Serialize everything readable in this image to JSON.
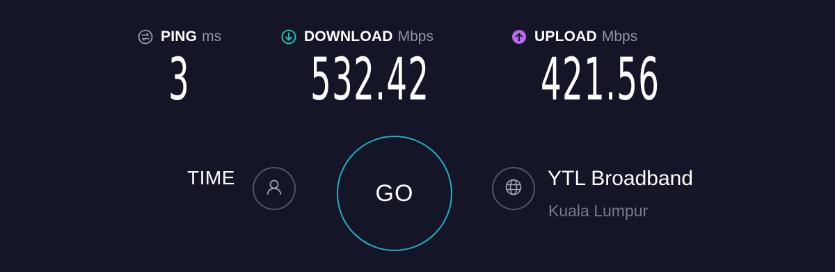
{
  "results": {
    "ping": {
      "label": "PING",
      "unit": "ms",
      "value": "3",
      "icon": "ping-icon",
      "color": "#9a9cb0"
    },
    "download": {
      "label": "DOWNLOAD",
      "unit": "Mbps",
      "value": "532.42",
      "icon": "download-arrow-icon",
      "color": "#1fd0c8"
    },
    "upload": {
      "label": "UPLOAD",
      "unit": "Mbps",
      "value": "421.56",
      "icon": "upload-arrow-icon",
      "color": "#b66ae8"
    }
  },
  "controls": {
    "time_label": "TIME",
    "go_label": "GO",
    "user_icon": "user-icon",
    "globe_icon": "globe-icon",
    "go_ring_color": "#1fb1c8"
  },
  "server": {
    "isp_name": "YTL Broadband",
    "location": "Kuala Lumpur"
  },
  "theme": {
    "background": "#141526",
    "muted_text": "#9193a8"
  }
}
